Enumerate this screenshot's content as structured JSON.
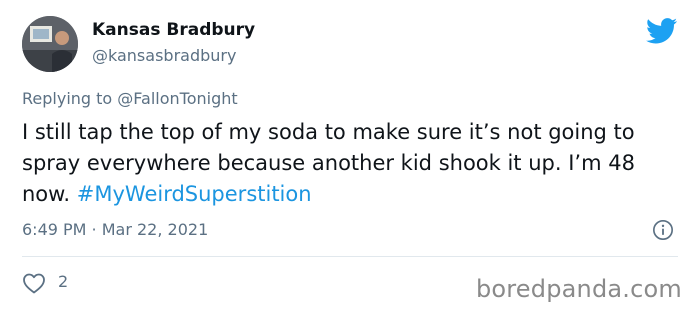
{
  "author": {
    "name": "Kansas Bradbury",
    "handle": "@kansasbradbury"
  },
  "reply": {
    "prefix": "Replying to ",
    "mention": "@FallonTonight"
  },
  "tweet": {
    "text": "I still tap the top of my soda to make sure it’s not going to spray everywhere because another kid shook it up. I’m 48 now. ",
    "hashtag": "#MyWeirdSuperstition"
  },
  "meta": {
    "timestamp": "6:49 PM · Mar 22, 2021"
  },
  "engagement": {
    "likes": "2"
  },
  "watermark": "boredpanda.com",
  "icons": {
    "brand": "twitter-bird-icon",
    "info": "info-icon",
    "like": "heart-icon"
  },
  "colors": {
    "twitter_blue": "#1da1f2",
    "hashtag_blue": "#1b95e0",
    "secondary_text": "#5b7083"
  }
}
